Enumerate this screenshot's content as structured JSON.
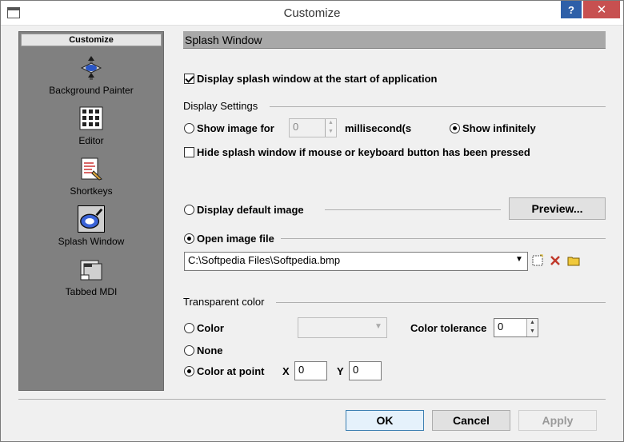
{
  "window": {
    "title": "Customize",
    "help": "?",
    "close": "✕"
  },
  "sidebar": {
    "header": "Customize",
    "items": [
      {
        "label": "Background Painter",
        "icon": "background-painter-icon"
      },
      {
        "label": "Editor",
        "icon": "editor-icon"
      },
      {
        "label": "Shortkeys",
        "icon": "shortkeys-icon"
      },
      {
        "label": "Splash Window",
        "icon": "splash-window-icon",
        "selected": true
      },
      {
        "label": "Tabbed MDI",
        "icon": "tabbed-mdi-icon"
      }
    ]
  },
  "main": {
    "section_title": "Splash Window",
    "display_splash": {
      "label": "Display splash window at the start of application",
      "checked": true
    },
    "display_settings": {
      "label": "Display Settings",
      "show_for": {
        "label": "Show image for",
        "value": "0",
        "unit": "millisecond(s",
        "selected": false
      },
      "show_infinitely": {
        "label": "Show infinitely",
        "selected": true
      },
      "hide_on_input": {
        "label": "Hide splash window if mouse or keyboard button has been pressed",
        "checked": false
      }
    },
    "default_image": {
      "label": "Display default image",
      "selected": false
    },
    "preview_button": "Preview...",
    "open_image": {
      "label": "Open image file",
      "selected": true
    },
    "image_path": "C:\\Softpedia Files\\Softpedia.bmp",
    "transparent": {
      "label": "Transparent color",
      "color": {
        "label": "Color",
        "selected": false
      },
      "tolerance": {
        "label": "Color tolerance",
        "value": "0"
      },
      "none": {
        "label": "None",
        "selected": false
      },
      "at_point": {
        "label": "Color at point",
        "selected": true
      },
      "x": {
        "label": "X",
        "value": "0"
      },
      "y": {
        "label": "Y",
        "value": "0"
      }
    }
  },
  "footer": {
    "ok": "OK",
    "cancel": "Cancel",
    "apply": "Apply"
  },
  "colors": {
    "accent": "#3c7fb1",
    "close": "#c75050",
    "help": "#2d5fa8",
    "sidebar": "#808080"
  }
}
